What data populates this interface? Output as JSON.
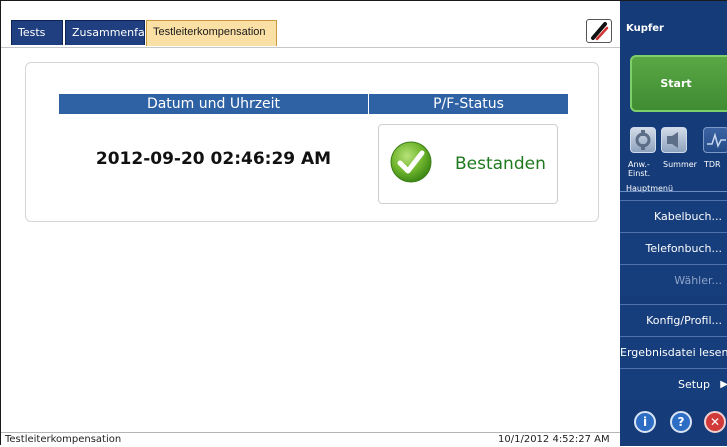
{
  "tabs": [
    {
      "label": "Tests"
    },
    {
      "label": "Zusammenfa."
    },
    {
      "label": "Testleiterkompensation",
      "active": true
    }
  ],
  "result": {
    "date_header": "Datum und Uhrzeit",
    "pf_header": "P/F-Status",
    "datetime": "2012-09-20 02:46:29 AM",
    "pf_status": "Bestanden",
    "pass_color": "#1f7a1f"
  },
  "statusbar": {
    "left": "Testleiterkompensation",
    "time": "10/1/2012 4:52:27 AM"
  },
  "side": {
    "title": "Kupfer",
    "start": "Start",
    "tools": [
      {
        "label": "Anw.- Einst.",
        "icon": "settings-icon"
      },
      {
        "label": "Summer",
        "icon": "speaker-icon"
      },
      {
        "label": "TDR",
        "icon": "waveform-icon"
      }
    ],
    "menu_heading": "Hauptmenü",
    "menu": [
      {
        "label": "Kabelbuch..."
      },
      {
        "label": "Telefonbuch..."
      },
      {
        "label": "Wähler..."
      },
      {
        "label": "Konfig/Profil..."
      },
      {
        "label": "Ergebnisdatei lesen"
      },
      {
        "label": "Setup"
      }
    ]
  },
  "colors": {
    "tab_active": "#fbe0a6",
    "tab_inactive": "#1f3f80",
    "header_blue": "#2f62a4",
    "side_panel": "#153b78",
    "start_green": "#4a9a3b"
  }
}
